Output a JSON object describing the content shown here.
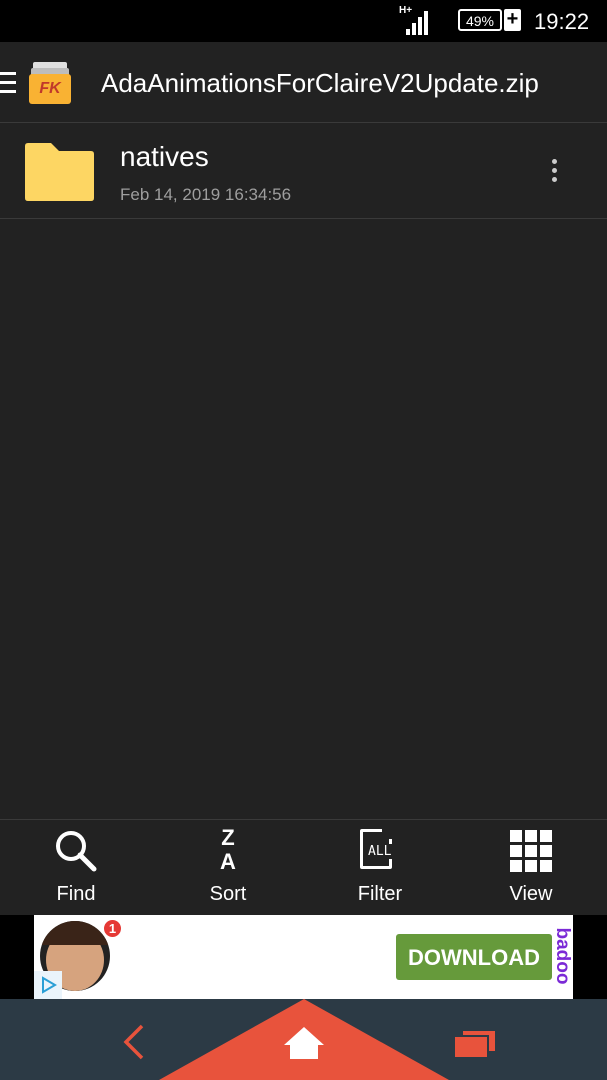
{
  "status_bar": {
    "network_label": "H+",
    "battery_percent": "49%",
    "time": "19:22",
    "icons": [
      "signal-icon",
      "battery-icon",
      "charging-icon"
    ]
  },
  "app_bar": {
    "title": "AdaAnimationsForClaireV2Update.zip",
    "logo_text": "FK",
    "icons": [
      "menu-icon",
      "app-logo-icon"
    ]
  },
  "files": [
    {
      "name": "natives",
      "date": "Feb 14, 2019 16:34:56",
      "icon": "folder-icon",
      "menu_icon": "more-vert-icon"
    }
  ],
  "toolbar": {
    "find_label": "Find",
    "sort_label": "Sort",
    "sort_icon_top": "Z",
    "sort_icon_bottom": "A",
    "filter_label": "Filter",
    "filter_icon_text": "ALL",
    "view_label": "View"
  },
  "ad": {
    "badge_count": "1",
    "button_label": "DOWNLOAD",
    "brand": "badoo",
    "button_color": "#669a3b",
    "brand_color": "#7b2ad6"
  },
  "nav_bar": {
    "icons": [
      "back-icon",
      "home-icon",
      "recents-icon"
    ],
    "accent_color": "#e8533c"
  },
  "colors": {
    "background": "#222222",
    "folder": "#fdd663",
    "status_bar": "#000000",
    "nav_bar": "#2c3a45"
  }
}
